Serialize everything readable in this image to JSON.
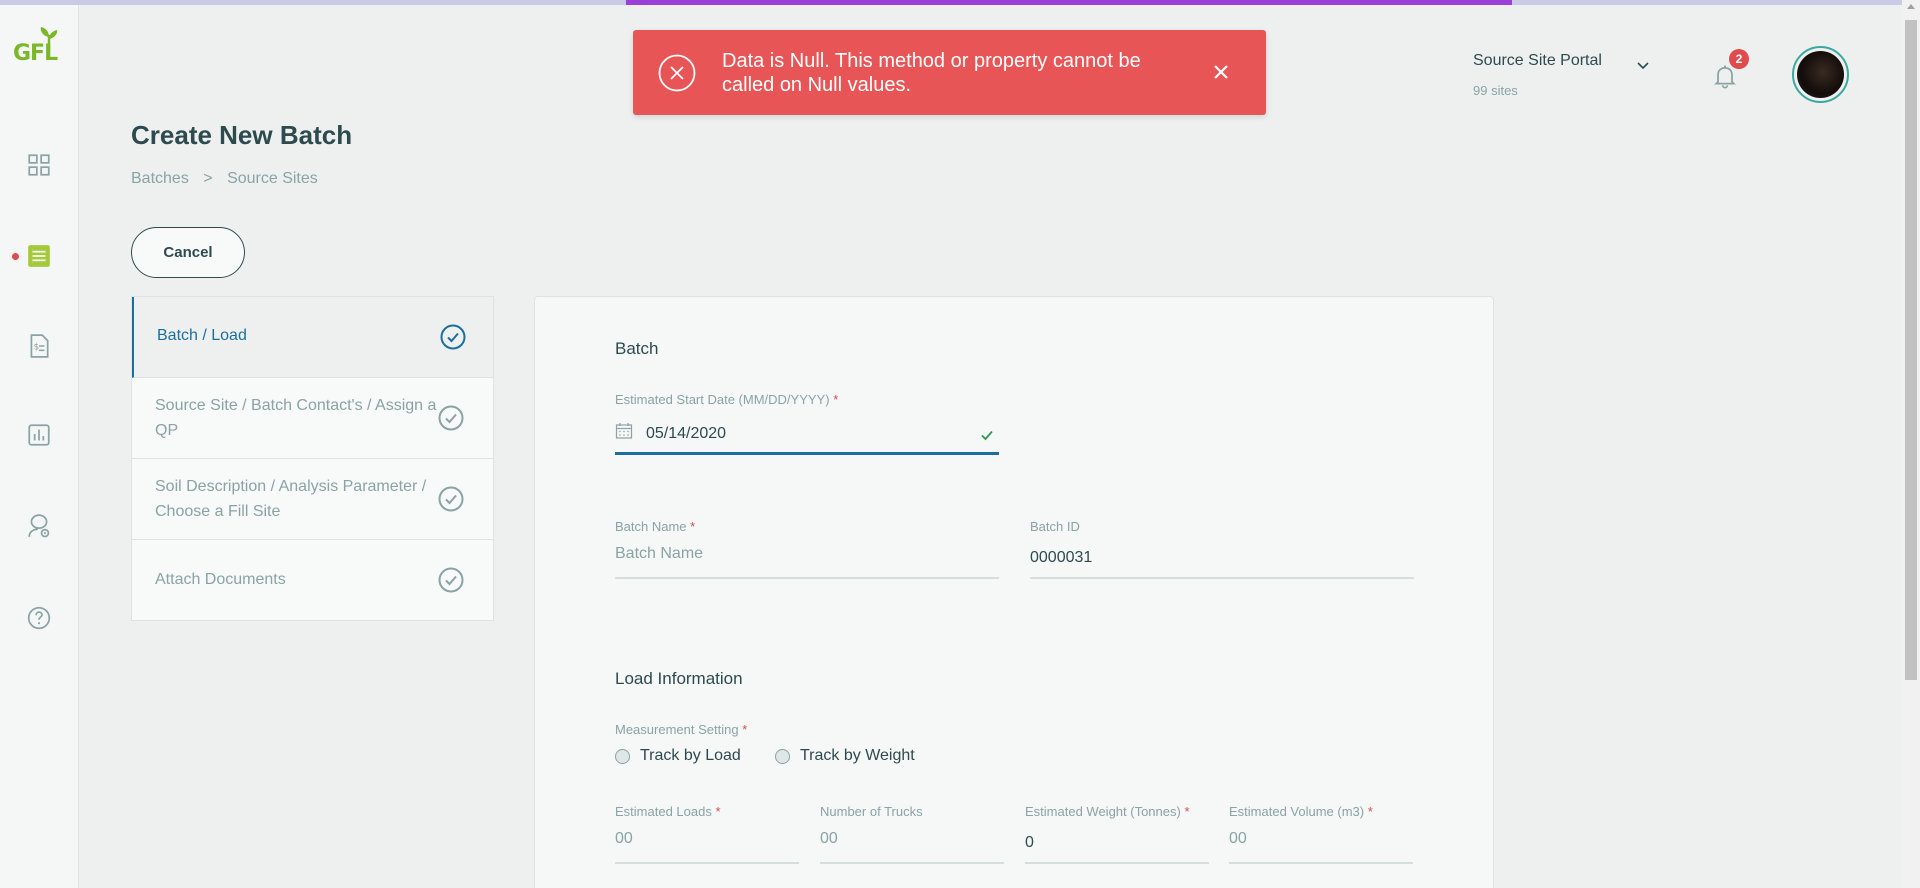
{
  "colors": {
    "accent": "#1c6e9e",
    "brand_green": "#7ab828",
    "error": "#e85556",
    "text": "#2d4a4e",
    "muted": "#8aa3a4"
  },
  "nav": {
    "logo": "GFL",
    "icons": [
      "dashboard-icon",
      "batches-icon",
      "invoice-icon",
      "reports-icon",
      "settings-user-icon",
      "help-icon"
    ]
  },
  "toast": {
    "message": "Data is Null. This method or property cannot be called on Null values."
  },
  "header": {
    "portal_name": "Source Site Portal",
    "portal_sites": "99 sites",
    "notification_count": "2"
  },
  "page": {
    "title": "Create New Batch",
    "breadcrumb": [
      "Batches",
      ">",
      "Source Sites"
    ],
    "cancel_label": "Cancel"
  },
  "steps": [
    {
      "label": "Batch / Load",
      "active": true
    },
    {
      "label": "Source Site / Batch Contact's / Assign a QP",
      "active": false
    },
    {
      "label": "Soil Description / Analysis Parameter / Choose a Fill Site",
      "active": false
    },
    {
      "label": "Attach Documents",
      "active": false
    }
  ],
  "form": {
    "batch_section": "Batch",
    "start_date_label": "Estimated Start Date (MM/DD/YYYY)",
    "start_date_value": "05/14/2020",
    "batch_name_label": "Batch Name",
    "batch_name_placeholder": "Batch Name",
    "batch_id_label": "Batch ID",
    "batch_id_value": "0000031",
    "load_section": "Load Information",
    "measurement_label": "Measurement Setting",
    "option_load": "Track by Load",
    "option_weight": "Track by Weight",
    "est_loads_label": "Estimated Loads",
    "est_loads_placeholder": "00",
    "trucks_label": "Number of Trucks",
    "trucks_placeholder": "00",
    "est_weight_label": "Estimated Weight (Tonnes)",
    "est_weight_value": "0",
    "est_volume_label": "Estimated Volume (m3)",
    "est_volume_placeholder": "00",
    "required_mark": "*"
  }
}
